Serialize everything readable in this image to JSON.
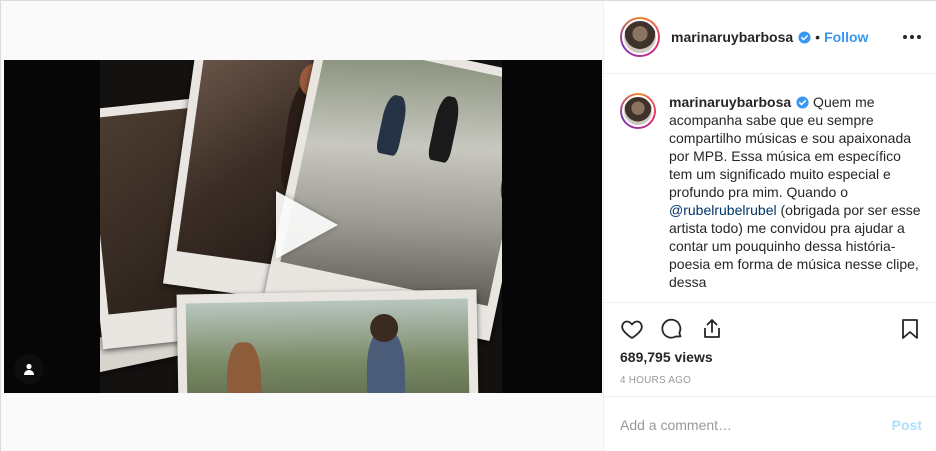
{
  "header": {
    "username": "marinaruybarbosa",
    "separator": "•",
    "follow_label": "Follow",
    "verified_icon": "verified-badge-icon",
    "more_icon": "more-options-icon"
  },
  "caption": {
    "username": "marinaruybarbosa",
    "text_1": " Quem me acompanha sabe que eu sempre compartilho músicas e sou apaixonada por MPB. Essa música em específico tem um significado muito especial e profundo pra mim. Quando o ",
    "mention": "@rubelrubelrubel",
    "text_2": " (obrigada por ser esse artista todo) me convidou pra ajudar a contar um pouquinho dessa história-poesia em forma de música nesse clipe, dessa"
  },
  "actions": {
    "like_icon": "heart-icon",
    "comment_icon": "comment-icon",
    "share_icon": "share-icon",
    "save_icon": "bookmark-icon"
  },
  "stats": {
    "views": "689,795 views",
    "time_ago": "4 HOURS AGO"
  },
  "comment": {
    "placeholder": "Add a comment…",
    "post_label": "Post"
  },
  "media": {
    "play_icon": "play-icon",
    "tagged_user_icon": "user-tag-icon"
  },
  "colors": {
    "link_blue": "#3897f0",
    "mention_blue": "#003569",
    "muted": "#999999",
    "post_disabled": "#b2dffc"
  }
}
